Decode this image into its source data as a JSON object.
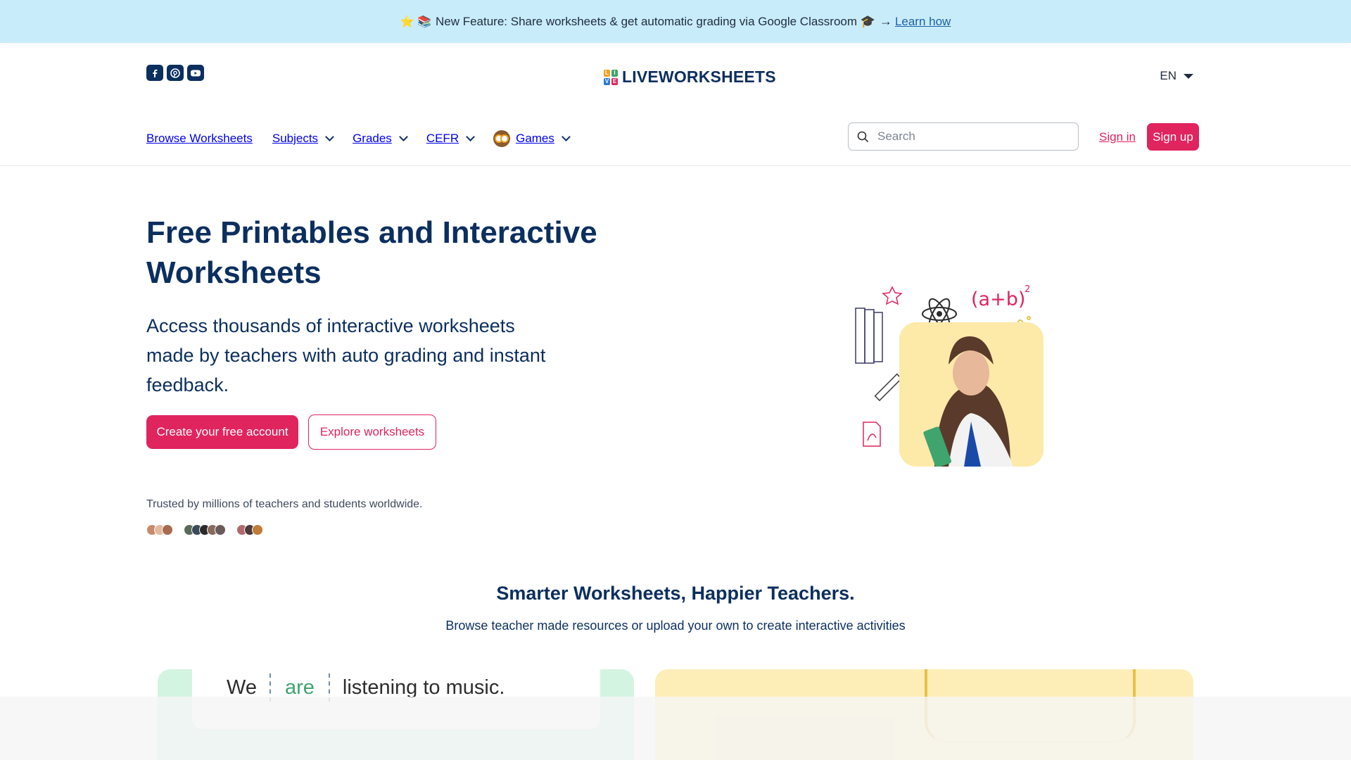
{
  "banner": {
    "icons": "⭐ 📚",
    "text": "New Feature: Share worksheets & get automatic grading via Google Classroom 🎓",
    "arrow": "→",
    "link": "Learn how"
  },
  "header": {
    "social": [
      "facebook-icon",
      "pinterest-icon",
      "youtube-icon"
    ],
    "logo_text": "LIVEWORKSHEETS",
    "language": "EN"
  },
  "nav": {
    "items": [
      {
        "label": "Browse Worksheets",
        "dropdown": false
      },
      {
        "label": "Subjects",
        "dropdown": true
      },
      {
        "label": "Grades",
        "dropdown": true
      },
      {
        "label": "CEFR",
        "dropdown": true
      },
      {
        "label": "Games",
        "dropdown": true
      }
    ],
    "search_placeholder": "Search",
    "sign_in": "Sign in",
    "sign_up": "Sign up"
  },
  "hero": {
    "title": "Free Printables and Interactive Worksheets",
    "subtitle": "Access thousands of interactive worksheets made by teachers with auto grading and instant feedback.",
    "primary_cta": "Create your free account",
    "secondary_cta": "Explore worksheets",
    "trusted": "Trusted by millions of teachers and students worldwide.",
    "illustration_formula": "(a+b)",
    "illustration_exponent": "2"
  },
  "section": {
    "title": "Smarter Worksheets, Happier Teachers.",
    "subtitle": "Browse teacher made resources or upload your own to create interactive activities"
  },
  "preview": {
    "sentence_start": "We",
    "sentence_gap": "are",
    "sentence_end": "listening to music."
  },
  "colors": {
    "brand": "#0b2f5e",
    "accent": "#e0245e",
    "banner": "#c9ecfa"
  }
}
